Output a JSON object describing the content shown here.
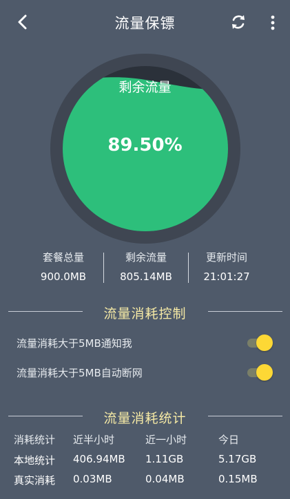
{
  "header": {
    "title": "流量保镖"
  },
  "gauge": {
    "label": "剩余流量",
    "percent_text": "89.50%",
    "fill_fraction": 0.895
  },
  "stats": [
    {
      "label": "套餐总量",
      "value": "900.0MB"
    },
    {
      "label": "剩余流量",
      "value": "805.14MB"
    },
    {
      "label": "更新时间",
      "value": "21:01:27"
    }
  ],
  "control": {
    "title": "流量消耗控制",
    "items": [
      {
        "label": "流量消耗大于5MB通知我",
        "on": true
      },
      {
        "label": "流量消耗大于5MB自动断网",
        "on": true
      }
    ]
  },
  "statistics": {
    "title": "流量消耗统计",
    "columns": [
      "消耗统计",
      "近半小时",
      "近一小时",
      "今日"
    ],
    "rows": [
      {
        "label": "本地统计",
        "values": [
          "406.94MB",
          "1.11GB",
          "5.17GB"
        ]
      },
      {
        "label": "真实消耗",
        "values": [
          "0.03MB",
          "0.04MB",
          "0.15MB"
        ]
      }
    ]
  },
  "colors": {
    "background": "#4f5a6a",
    "gauge_fill": "#2dbf7b",
    "gauge_ring": "#3f4652",
    "gauge_empty": "#2b313a",
    "section_title": "#f5e9a5",
    "toggle_knob": "#fdd835"
  }
}
